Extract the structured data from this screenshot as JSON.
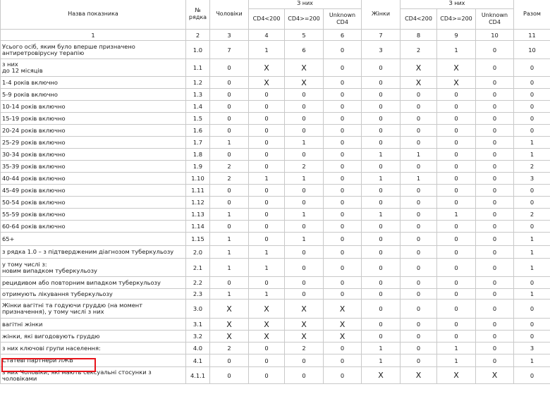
{
  "header": {
    "name": "Назва показника",
    "code": "№ рядка",
    "men": "Чоловіки",
    "of_them_men": "З них",
    "cd4_lt200": "CD4<200",
    "cd4_ge200": "CD4>=200",
    "unknown_cd4": "Unknown CD4",
    "women": "Жінки",
    "of_them_women": "З них",
    "total": "Разом"
  },
  "column_numbers": [
    "1",
    "2",
    "3",
    "4",
    "5",
    "6",
    "7",
    "8",
    "9",
    "10",
    "11"
  ],
  "rows": [
    {
      "name": "Усього осіб, яким було вперше призначено антиретровірусну терапію",
      "code": "1.0",
      "v": [
        "7",
        "1",
        "6",
        "0",
        "3",
        "2",
        "1",
        "0",
        "10"
      ]
    },
    {
      "name": "з них\nдо 12 місяців",
      "code": "1.1",
      "v": [
        "0",
        "X",
        "X",
        "0",
        "0",
        "X",
        "X",
        "0",
        "0"
      ]
    },
    {
      "name": "1-4 років включно",
      "code": "1.2",
      "v": [
        "0",
        "X",
        "X",
        "0",
        "0",
        "X",
        "X",
        "0",
        "0"
      ]
    },
    {
      "name": "5-9 років включно",
      "code": "1.3",
      "v": [
        "0",
        "0",
        "0",
        "0",
        "0",
        "0",
        "0",
        "0",
        "0"
      ]
    },
    {
      "name": "10-14 років включно",
      "code": "1.4",
      "v": [
        "0",
        "0",
        "0",
        "0",
        "0",
        "0",
        "0",
        "0",
        "0"
      ]
    },
    {
      "name": "15-19 років включно",
      "code": "1.5",
      "v": [
        "0",
        "0",
        "0",
        "0",
        "0",
        "0",
        "0",
        "0",
        "0"
      ]
    },
    {
      "name": "20-24 років включно",
      "code": "1.6",
      "v": [
        "0",
        "0",
        "0",
        "0",
        "0",
        "0",
        "0",
        "0",
        "0"
      ]
    },
    {
      "name": "25-29 років включно",
      "code": "1.7",
      "v": [
        "1",
        "0",
        "1",
        "0",
        "0",
        "0",
        "0",
        "0",
        "1"
      ]
    },
    {
      "name": "30-34 років включно",
      "code": "1.8",
      "v": [
        "0",
        "0",
        "0",
        "0",
        "1",
        "1",
        "0",
        "0",
        "1"
      ]
    },
    {
      "name": "35-39 років включно",
      "code": "1.9",
      "v": [
        "2",
        "0",
        "2",
        "0",
        "0",
        "0",
        "0",
        "0",
        "2"
      ]
    },
    {
      "name": "40-44 років включно",
      "code": "1.10",
      "v": [
        "2",
        "1",
        "1",
        "0",
        "1",
        "1",
        "0",
        "0",
        "3"
      ]
    },
    {
      "name": "45-49 років включно",
      "code": "1.11",
      "v": [
        "0",
        "0",
        "0",
        "0",
        "0",
        "0",
        "0",
        "0",
        "0"
      ]
    },
    {
      "name": "50-54 років включно",
      "code": "1.12",
      "v": [
        "0",
        "0",
        "0",
        "0",
        "0",
        "0",
        "0",
        "0",
        "0"
      ]
    },
    {
      "name": "55-59 років включно",
      "code": "1.13",
      "v": [
        "1",
        "0",
        "1",
        "0",
        "1",
        "0",
        "1",
        "0",
        "2"
      ]
    },
    {
      "name": "60-64 років включно",
      "code": "1.14",
      "v": [
        "0",
        "0",
        "0",
        "0",
        "0",
        "0",
        "0",
        "0",
        "0"
      ]
    },
    {
      "name": "65+",
      "code": "1.15",
      "v": [
        "1",
        "0",
        "1",
        "0",
        "0",
        "0",
        "0",
        "0",
        "1"
      ]
    },
    {
      "name": "з рядка 1.0 – з підтвердженим діагнозом туберкульозу",
      "code": "2.0",
      "v": [
        "1",
        "1",
        "0",
        "0",
        "0",
        "0",
        "0",
        "0",
        "1"
      ]
    },
    {
      "name": "у тому числі з:\nновим випадком туберкульозу",
      "code": "2.1",
      "v": [
        "1",
        "1",
        "0",
        "0",
        "0",
        "0",
        "0",
        "0",
        "1"
      ]
    },
    {
      "name": "рецидивом або повторним випадком туберкульозу",
      "code": "2.2",
      "v": [
        "0",
        "0",
        "0",
        "0",
        "0",
        "0",
        "0",
        "0",
        "0"
      ]
    },
    {
      "name": "отримують лікування туберкульозу",
      "code": "2.3",
      "v": [
        "1",
        "1",
        "0",
        "0",
        "0",
        "0",
        "0",
        "0",
        "1"
      ]
    },
    {
      "name": "Жінки вагітні та годуючи груддю (на момент призначення), у тому числі з них",
      "code": "3.0",
      "v": [
        "X",
        "X",
        "X",
        "X",
        "0",
        "0",
        "0",
        "0",
        "0"
      ]
    },
    {
      "name": "вагітні жінки",
      "code": "3.1",
      "v": [
        "X",
        "X",
        "X",
        "X",
        "0",
        "0",
        "0",
        "0",
        "0"
      ]
    },
    {
      "name": "жінки, які вигодовують груддю",
      "code": "3.2",
      "v": [
        "X",
        "X",
        "X",
        "X",
        "0",
        "0",
        "0",
        "0",
        "0"
      ]
    },
    {
      "name": "з них ключові групи населення:",
      "code": "4.0",
      "v": [
        "2",
        "0",
        "2",
        "0",
        "1",
        "0",
        "1",
        "0",
        "3"
      ]
    },
    {
      "name": "Статеві партнери ЛЖВ",
      "code": "4.1",
      "v": [
        "0",
        "0",
        "0",
        "0",
        "1",
        "0",
        "1",
        "0",
        "1"
      ]
    },
    {
      "name": "з них Чоловіки, які мають сексуальні стосунки з чоловіками",
      "code": "4.1.1",
      "v": [
        "0",
        "0",
        "0",
        "0",
        "X",
        "X",
        "X",
        "X",
        "0"
      ]
    }
  ]
}
